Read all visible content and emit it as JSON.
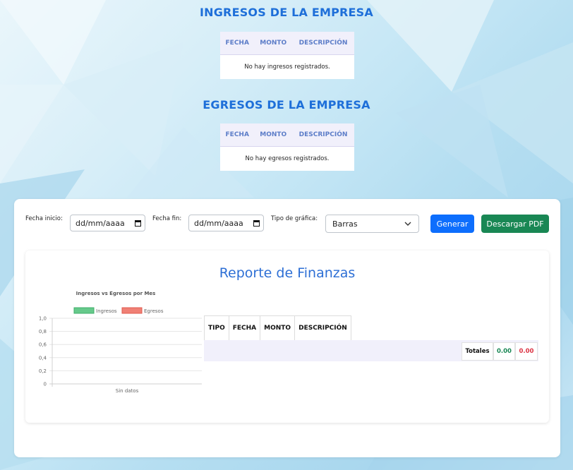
{
  "ingresos": {
    "title": "INGRESOS DE LA EMPRESA",
    "columns": [
      "FECHA",
      "MONTO",
      "DESCRIPCIÓN"
    ],
    "empty_message": "No hay ingresos registrados."
  },
  "egresos": {
    "title": "EGRESOS DE LA EMPRESA",
    "columns": [
      "FECHA",
      "MONTO",
      "DESCRIPCIÓN"
    ],
    "empty_message": "No hay egresos registrados."
  },
  "filters": {
    "start_label": "Fecha inicio:",
    "start_value": "dd/mm/aaaa",
    "end_label": "Fecha fin:",
    "end_value": "dd/mm/aaaa",
    "chart_type_label": "Tipo de gráfica:",
    "chart_type_value": "Barras",
    "generate_label": "Generar",
    "pdf_label": "Descargar PDF"
  },
  "report": {
    "title": "Reporte de Finanzas",
    "columns": [
      "TIPO",
      "FECHA",
      "MONTO",
      "DESCRIPCIÓN"
    ],
    "totals_label": "Totales",
    "total_income": "0.00",
    "total_expense": "0.00"
  },
  "colors": {
    "title_blue": "#1e6fd9",
    "generate_button": "#0d6efd",
    "pdf_button": "#198754",
    "income_green": "#198754",
    "expense_red": "#dc3545",
    "legend_income": "#66c98b",
    "legend_expense": "#f08075"
  },
  "chart_data": {
    "type": "bar",
    "title": "Ingresos vs Egresos por Mes",
    "categories": [
      "Sin datos"
    ],
    "series": [
      {
        "name": "Ingresos",
        "values": [
          0
        ]
      },
      {
        "name": "Egresos",
        "values": [
          0
        ]
      }
    ],
    "ylim": [
      0,
      1
    ],
    "yticks": [
      "1,0",
      "0,8",
      "0,6",
      "0,4",
      "0,2",
      "0"
    ],
    "legend": "top",
    "grid": true
  }
}
